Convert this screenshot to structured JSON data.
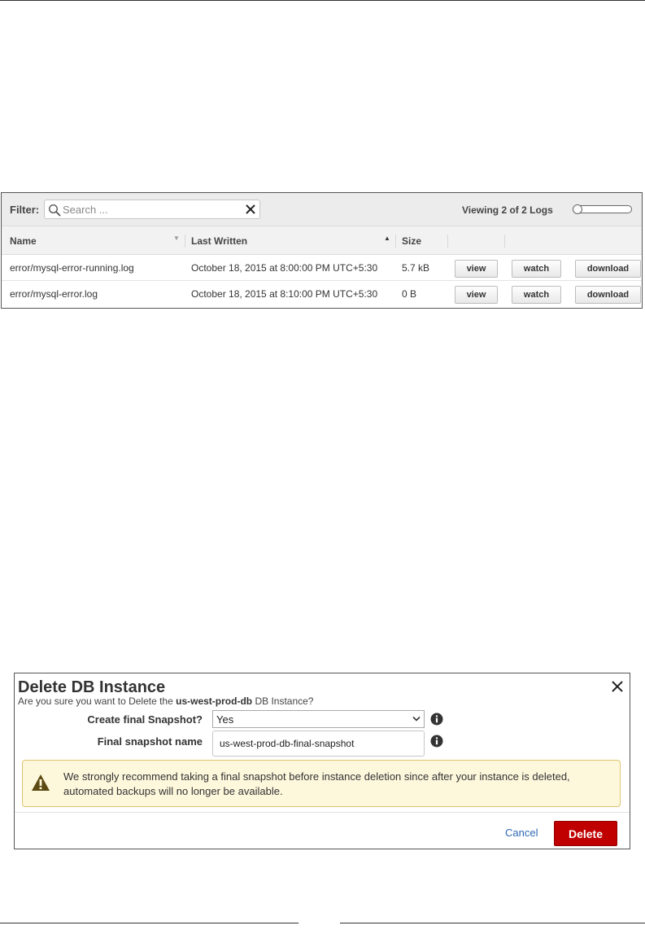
{
  "logs": {
    "filter_label": "Filter:",
    "search_placeholder": "Search ...",
    "viewing_text": "Viewing 2 of 2 Logs",
    "columns": {
      "name": "Name",
      "last_written": "Last Written",
      "size": "Size"
    },
    "rows": [
      {
        "name": "error/mysql-error-running.log",
        "last_written": "October 18, 2015 at 8:00:00 PM UTC+5:30",
        "size": "5.7 kB",
        "view": "view",
        "watch": "watch",
        "download": "download"
      },
      {
        "name": "error/mysql-error.log",
        "last_written": "October 18, 2015 at 8:10:00 PM UTC+5:30",
        "size": "0 B",
        "view": "view",
        "watch": "watch",
        "download": "download"
      }
    ]
  },
  "dialog": {
    "title": "Delete DB Instance",
    "subtitle_prefix": "Are you sure you want to Delete the ",
    "instance_name": "us-west-prod-db",
    "subtitle_suffix": " DB Instance?",
    "snapshot_label": "Create final Snapshot?",
    "snapshot_value": "Yes",
    "snapshot_name_label": "Final snapshot name",
    "snapshot_name_value": "us-west-prod-db-final-snapshot",
    "warning": "We strongly recommend taking a final snapshot before instance deletion since after your instance is deleted, automated backups will no longer be available.",
    "cancel_label": "Cancel",
    "delete_label": "Delete"
  },
  "colors": {
    "delete_button": "#c00000",
    "warning_bg": "#fdf7dc",
    "warning_border": "#dfc570",
    "link": "#2f68b5"
  }
}
